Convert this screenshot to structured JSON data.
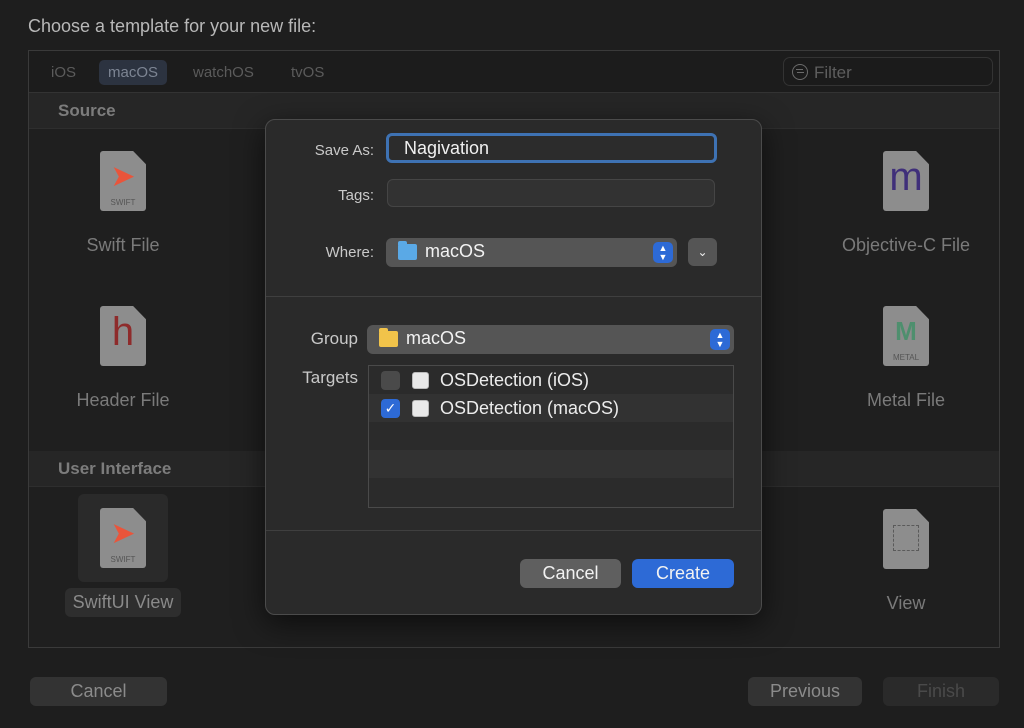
{
  "chooser": {
    "title": "Choose a template for your new file:",
    "platforms": [
      "iOS",
      "macOS",
      "watchOS",
      "tvOS"
    ],
    "selected_platform": "macOS",
    "filter_placeholder": "Filter",
    "sections": [
      {
        "title": "Source",
        "templates": [
          {
            "name": "Swift File",
            "icon": "swift-file-icon",
            "badge": "SWIFT"
          },
          {
            "name": "Objective-C File",
            "icon": "objc-file-icon",
            "glyph": "m"
          },
          {
            "name": "Header File",
            "icon": "header-file-icon",
            "glyph": "h"
          },
          {
            "name": "Metal File",
            "icon": "metal-file-icon",
            "badge": "METAL"
          }
        ]
      },
      {
        "title": "User Interface",
        "templates": [
          {
            "name": "SwiftUI View",
            "icon": "swiftui-file-icon",
            "badge": "SWIFT"
          },
          {
            "name": "View",
            "icon": "view-file-icon"
          }
        ]
      }
    ],
    "buttons": {
      "cancel": "Cancel",
      "previous": "Previous",
      "finish": "Finish"
    }
  },
  "sheet": {
    "save_as_label": "Save As:",
    "save_as_value": "Nagivation",
    "tags_label": "Tags:",
    "tags_value": "",
    "where_label": "Where:",
    "where_value": "macOS",
    "group_label": "Group",
    "group_value": "macOS",
    "targets_label": "Targets",
    "targets": [
      {
        "name": "OSDetection (iOS)",
        "checked": false
      },
      {
        "name": "OSDetection (macOS)",
        "checked": true
      }
    ],
    "cancel_label": "Cancel",
    "create_label": "Create"
  },
  "colors": {
    "accent": "#2d6ad6",
    "focus_ring": "#3e72b3",
    "folder_blue": "#5aa9e6",
    "folder_yellow": "#f1c34a",
    "swift_orange": "#e9553b",
    "header_red": "#8e2b2b",
    "objc_purple": "#3f2f7a",
    "metal_green": "#4e8f6e"
  }
}
